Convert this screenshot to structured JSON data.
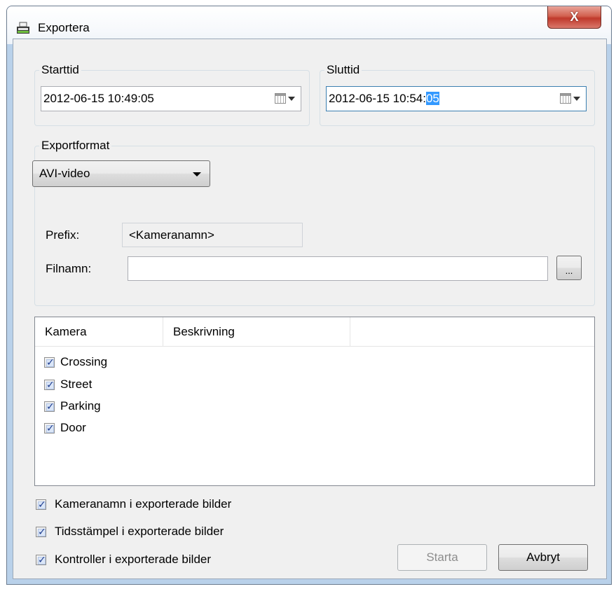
{
  "window": {
    "title": "Exportera",
    "close_label": "X"
  },
  "start": {
    "label": "Starttid",
    "value": "2012-06-15 10:49:05"
  },
  "end": {
    "label": "Sluttid",
    "value_prefix": "2012-06-15 10:54:",
    "value_selected": "05"
  },
  "format": {
    "label": "Exportformat",
    "selected": "AVI-video",
    "prefix_label": "Prefix:",
    "prefix_value": "<Kameranamn>",
    "filename_label": "Filnamn:",
    "filename_value": "",
    "browse_label": "..."
  },
  "cameras": {
    "columns": [
      "Kamera",
      "Beskrivning",
      ""
    ],
    "items": [
      {
        "name": "Crossing",
        "checked": true
      },
      {
        "name": "Street",
        "checked": true
      },
      {
        "name": "Parking",
        "checked": true
      },
      {
        "name": "Door",
        "checked": true
      }
    ]
  },
  "options": [
    {
      "label": "Kameranamn i exporterade bilder",
      "checked": true
    },
    {
      "label": "Tidsstämpel i exporterade bilder",
      "checked": true
    },
    {
      "label": "Kontroller i exporterade bilder",
      "checked": true
    }
  ],
  "buttons": {
    "start": "Starta",
    "cancel": "Avbryt"
  },
  "icons": {
    "window": "export-window-icon",
    "calendar": "calendar-icon",
    "dropdown": "chevron-down-icon",
    "check": "checkbox-check-icon"
  }
}
